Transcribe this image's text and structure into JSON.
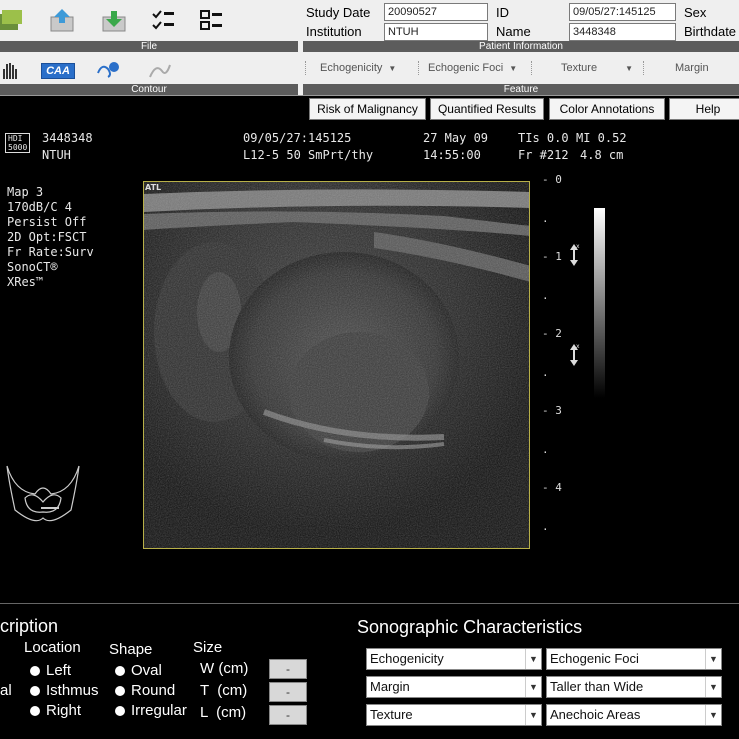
{
  "file_group": {
    "label": "File"
  },
  "contour_group": {
    "label": "Contour",
    "caa_label": "CAA"
  },
  "patient_info": {
    "group_label": "Patient Information",
    "study_date_label": "Study Date",
    "study_date_value": "20090527",
    "id_label": "ID",
    "id_value": "09/05/27:145125",
    "sex_label": "Sex",
    "institution_label": "Institution",
    "institution_value": "NTUH",
    "name_label": "Name",
    "name_value": "3448348",
    "birthdate_label": "Birthdate"
  },
  "feature_group": {
    "label": "Feature",
    "items": [
      "Echogenicity",
      "Echogenic Foci",
      "Texture",
      "Margin"
    ]
  },
  "actions": {
    "risk": "Risk of Malignancy",
    "quantified": "Quantified Results",
    "color": "Color Annotations",
    "help": "Help"
  },
  "ultrasound": {
    "hdi_line1": "HDI",
    "hdi_line2": "5000",
    "patient_id": "3448348",
    "institution": "NTUH",
    "study_id": "09/05/27:145125",
    "probe": "L12-5 50 SmPrt/thy",
    "date": "27 May 09",
    "time": "14:55:00",
    "tis": "TIs 0.0",
    "mi": "MI 0.52",
    "frame": "Fr #212",
    "depth": "4.8 cm",
    "settings": [
      "Map 3",
      "170dB/C 4",
      "Persist Off",
      "2D Opt:FSCT",
      "Fr Rate:Surv",
      "SonoCT®",
      "XRes™"
    ],
    "atl_mark": "ATL",
    "scale_marks": [
      "0",
      "1",
      "2",
      "3",
      "4"
    ]
  },
  "description": {
    "title": "cription",
    "location_head": "Location",
    "shape_head": "Shape",
    "size_head": "Size",
    "side_label": "al",
    "locations": [
      "Left",
      "Isthmus",
      "Right"
    ],
    "shapes": [
      "Oval",
      "Round",
      "Irregular"
    ],
    "sizes": [
      "W (cm)",
      "T  (cm)",
      "L  (cm)"
    ],
    "size_button": "-"
  },
  "sonographic": {
    "title": "Sonographic Characteristics",
    "selects": [
      "Echogenicity",
      "Echogenic Foci",
      "Margin",
      "Taller than Wide",
      "Texture",
      "Anechoic Areas"
    ]
  },
  "colors": {
    "toolbar_bg": "#efefef",
    "group_bar": "#5c5c5c",
    "image_border": "#b8b048"
  }
}
